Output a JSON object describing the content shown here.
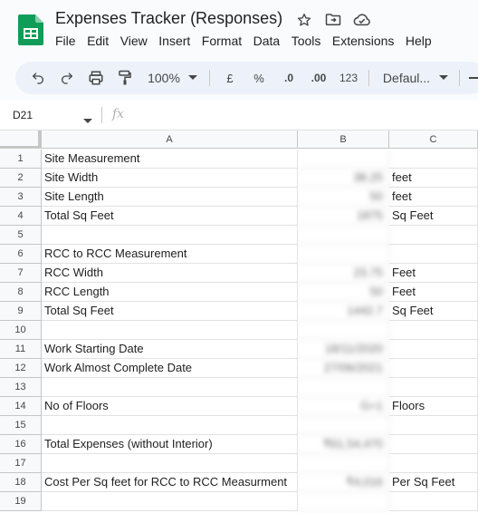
{
  "app": {
    "title": "Expenses Tracker (Responses)",
    "menu": [
      "File",
      "Edit",
      "View",
      "Insert",
      "Format",
      "Data",
      "Tools",
      "Extensions",
      "Help"
    ]
  },
  "toolbar": {
    "zoom": "100%",
    "currency": "£",
    "percent": "%",
    "decrease_decimal": ".0",
    "increase_decimal": ".00",
    "number_format": "123",
    "font": "Defaul..."
  },
  "formula_bar": {
    "cell_ref": "D21",
    "fx": "fx"
  },
  "columns": [
    "A",
    "B",
    "C"
  ],
  "rows": [
    {
      "num": "1",
      "a": "Site Measurement",
      "b": "",
      "c": ""
    },
    {
      "num": "2",
      "a": "Site Width",
      "b": "38.25",
      "c": "feet"
    },
    {
      "num": "3",
      "a": "Site Length",
      "b": "50",
      "c": "feet"
    },
    {
      "num": "4",
      "a": "Total Sq Feet",
      "b": "1875",
      "c": "Sq Feet"
    },
    {
      "num": "5",
      "a": "",
      "b": "",
      "c": ""
    },
    {
      "num": "6",
      "a": "RCC to RCC Measurement",
      "b": "",
      "c": ""
    },
    {
      "num": "7",
      "a": "RCC Width",
      "b": "23.75",
      "c": "Feet"
    },
    {
      "num": "8",
      "a": "RCC Length",
      "b": "50",
      "c": "Feet"
    },
    {
      "num": "9",
      "a": "Total Sq Feet",
      "b": "1442.7",
      "c": "Sq Feet"
    },
    {
      "num": "10",
      "a": "",
      "b": "",
      "c": ""
    },
    {
      "num": "11",
      "a": "Work Starting Date",
      "b": "18/11/2020",
      "c": ""
    },
    {
      "num": "12",
      "a": "Work Almost Complete Date",
      "b": "27/06/2021",
      "c": ""
    },
    {
      "num": "13",
      "a": "",
      "b": "",
      "c": ""
    },
    {
      "num": "14",
      "a": "No of Floors",
      "b": "G+1",
      "c": "Floors"
    },
    {
      "num": "15",
      "a": "",
      "b": "",
      "c": ""
    },
    {
      "num": "16",
      "a": "Total Expenses (without Interior)",
      "b": "₹61,54,470",
      "c": ""
    },
    {
      "num": "17",
      "a": "",
      "b": "",
      "c": ""
    },
    {
      "num": "18",
      "a": "Cost Per Sq feet for RCC to RCC Measurment",
      "b": "₹4,016",
      "c": "Per Sq Feet"
    },
    {
      "num": "19",
      "a": "",
      "b": "",
      "c": ""
    }
  ]
}
